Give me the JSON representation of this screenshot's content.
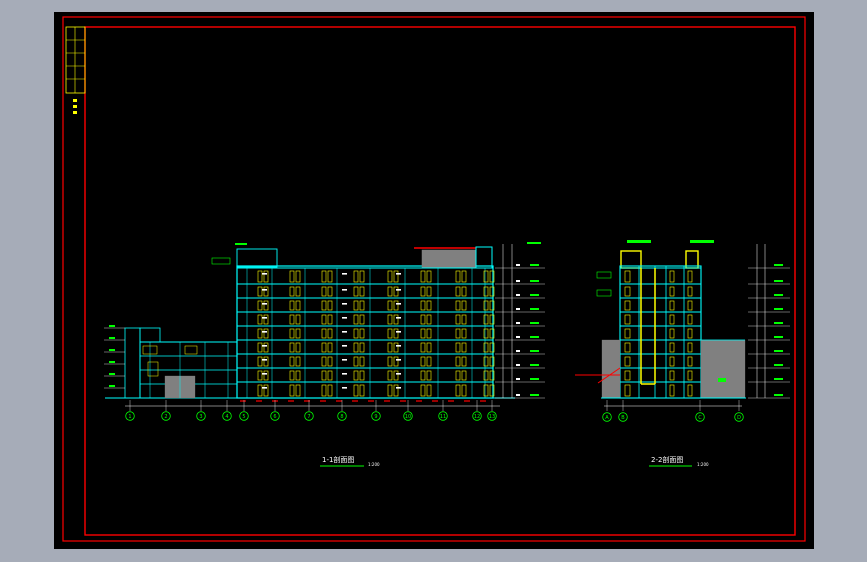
{
  "viewer": {
    "background": "#a6acb8",
    "sheet_color": "#000000",
    "frame_color": "#ff0000"
  },
  "section_1": {
    "title": "1-1剖面图",
    "scale": "1:200",
    "axis_labels": [
      "1",
      "2",
      "3",
      "4",
      "5",
      "6",
      "7",
      "8",
      "9",
      "10",
      "11",
      "12",
      "13"
    ]
  },
  "section_2": {
    "title": "2-2剖面图",
    "scale": "1:200",
    "axis_labels": [
      "A",
      "B",
      "C",
      "D"
    ]
  },
  "colors": {
    "cyan": "#00ffff",
    "yellow": "#ffff00",
    "green": "#00ff00",
    "red": "#ff0000",
    "white": "#ffffff",
    "gray": "#808080"
  }
}
